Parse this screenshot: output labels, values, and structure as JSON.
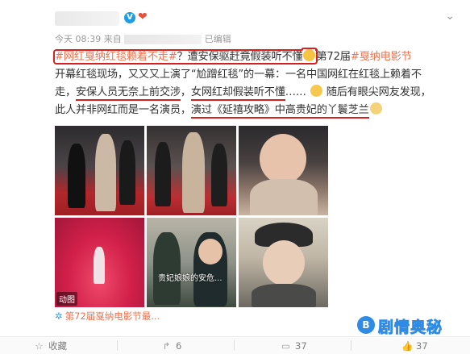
{
  "header": {
    "user_name": "user",
    "verified_badge": "V",
    "time": "今天 08:39 来自",
    "source_blurred": "source",
    "edited": "已编辑",
    "menu_icon": "chevron-down-icon"
  },
  "post": {
    "line1_topic": "#网红戛纳红毯赖着不走#",
    "line1_rest": "？遭安保驱赶竟假装听不懂",
    "line1_tail": "第72届",
    "line1_topic2": "#戛纳电影节",
    "line2": "开幕红毯现场，又又又上演了“尬蹭红毯”的一幕：一名中国网红在红毯上赖着不",
    "line3": "走，",
    "line3_u1": "安保人员无奈上前交涉",
    "line3_mid": "，",
    "line3_u2": "女网红却假装听不懂",
    "line3_rest": "…… ",
    "line3_tail": " 随后有眼尖网友发现，",
    "line4_a": "此人并非网红而是一名演员，",
    "line4_u": "演过《延禧攻略》中高贵妃的丫鬟芝兰",
    "gif_label": "动图",
    "subtitle_text": "贵妃娘娘的安危..."
  },
  "topic": {
    "icon": "topic-icon",
    "label": "第72届戛纳电影节最..."
  },
  "watermark": {
    "icon_glyph": "B",
    "text": "剧情奥秘"
  },
  "actions": {
    "collect": "收藏",
    "repost": "6",
    "comment": "37",
    "like": "37"
  },
  "colors": {
    "link": "#eb7350",
    "annotation_red": "#d62020",
    "meta_gray": "#999999"
  }
}
